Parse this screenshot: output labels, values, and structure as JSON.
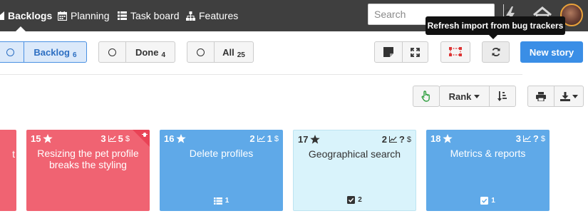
{
  "nav": {
    "items": [
      {
        "label": "Backlogs",
        "active": true
      },
      {
        "label": "Planning"
      },
      {
        "label": "Task board"
      },
      {
        "label": "Features"
      }
    ],
    "search_placeholder": "Search"
  },
  "tooltip": "Refresh import from bug trackers",
  "toolbar": {
    "filters": [
      {
        "label": "Backlog",
        "count": "6",
        "selected": true
      },
      {
        "label": "Done",
        "count": "4"
      },
      {
        "label": "All",
        "count": "25"
      }
    ],
    "new_story": "New story",
    "sort_label": "Rank"
  },
  "cards": [
    {
      "id": "",
      "title": "t",
      "color": "#f06372"
    },
    {
      "id": "15",
      "points": "3",
      "value": "5",
      "title": "Resizing the pet profile breaks the styling",
      "color": "#f06372",
      "flag": true
    },
    {
      "id": "16",
      "points": "2",
      "value": "1",
      "title": "Delete profiles",
      "footer_count": "1",
      "color": "#5fa9e8"
    },
    {
      "id": "17",
      "points": "2",
      "value": "?",
      "title": "Geographical search",
      "footer_count": "2",
      "color": "#d9f3fb"
    },
    {
      "id": "18",
      "points": "3",
      "value": "?",
      "title": "Metrics & reports",
      "footer_count": "1",
      "color": "#5fa9e8"
    }
  ],
  "colors": {
    "accent": "#3a8ee6",
    "topbar": "#3f3f3f"
  },
  "icons": [
    "home-icon",
    "calendar-icon",
    "taskboard-icon",
    "features-icon",
    "search-icon",
    "bolt-icon",
    "house-icon",
    "note-icon",
    "expand-icon",
    "screen-select-icon",
    "refresh-icon",
    "hand-pointer-icon",
    "sort-icon",
    "print-icon",
    "download-icon",
    "star-icon",
    "chart-icon",
    "list-icon",
    "checkbox-icon"
  ]
}
